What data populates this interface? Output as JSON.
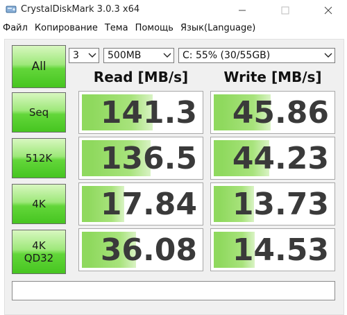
{
  "window": {
    "title": "CrystalDiskMark 3.0.3 x64"
  },
  "menu": [
    {
      "label": "Файл"
    },
    {
      "label": "Копирование"
    },
    {
      "label": "Тема"
    },
    {
      "label": "Помощь"
    },
    {
      "label": "Язык(Language)"
    }
  ],
  "controls": {
    "all_label": "All",
    "test_count": "3",
    "test_size": "500MB",
    "drive": "C: 55% (30/55GB)"
  },
  "headers": {
    "read": "Read [MB/s]",
    "write": "Write [MB/s]"
  },
  "rows": [
    {
      "label": "Seq",
      "label2": "",
      "read": "141.3",
      "write": "45.86",
      "read_fill": 0.6,
      "write_fill": 0.48
    },
    {
      "label": "512K",
      "label2": "",
      "read": "136.5",
      "write": "44.23",
      "read_fill": 0.58,
      "write_fill": 0.47
    },
    {
      "label": "4K",
      "label2": "",
      "read": "17.84",
      "write": "13.73",
      "read_fill": 0.36,
      "write_fill": 0.34
    },
    {
      "label": "4K",
      "label2": "QD32",
      "read": "36.08",
      "write": "14.53",
      "read_fill": 0.46,
      "write_fill": 0.35
    }
  ],
  "comment": "",
  "colors": {
    "button_green": "#63d63a",
    "bar_green": "#8fd95e",
    "value_text": "#3a3a3a"
  }
}
